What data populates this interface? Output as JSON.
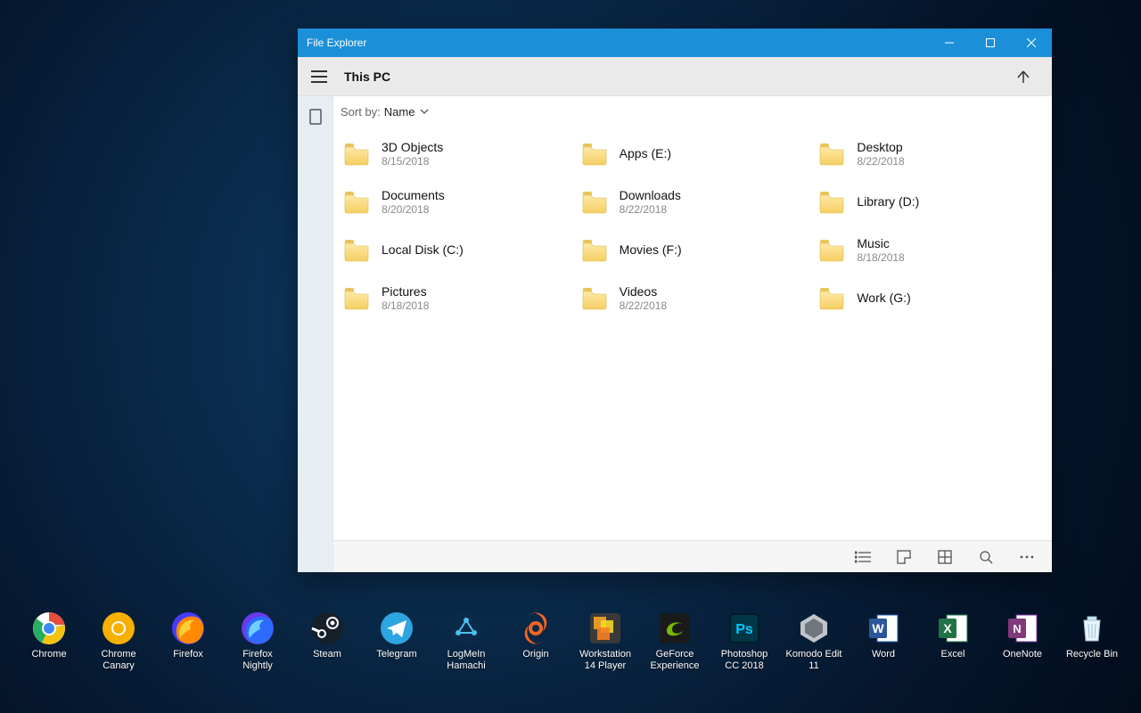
{
  "window": {
    "title": "File Explorer",
    "location": "This PC",
    "sort_label": "Sort by:",
    "sort_value": "Name"
  },
  "items": [
    {
      "name": "3D Objects",
      "date": "8/15/2018"
    },
    {
      "name": "Apps (E:)",
      "date": ""
    },
    {
      "name": "Desktop",
      "date": "8/22/2018"
    },
    {
      "name": "Documents",
      "date": "8/20/2018"
    },
    {
      "name": "Downloads",
      "date": "8/22/2018"
    },
    {
      "name": "Library (D:)",
      "date": ""
    },
    {
      "name": "Local Disk (C:)",
      "date": ""
    },
    {
      "name": "Movies (F:)",
      "date": ""
    },
    {
      "name": "Music",
      "date": "8/18/2018"
    },
    {
      "name": "Pictures",
      "date": "8/18/2018"
    },
    {
      "name": "Videos",
      "date": "8/22/2018"
    },
    {
      "name": "Work (G:)",
      "date": ""
    }
  ],
  "dock": [
    {
      "label": "Chrome",
      "icon": "chrome"
    },
    {
      "label": "Chrome\nCanary",
      "icon": "canary"
    },
    {
      "label": "Firefox",
      "icon": "firefox"
    },
    {
      "label": "Firefox\nNightly",
      "icon": "firefox-nightly"
    },
    {
      "label": "Steam",
      "icon": "steam"
    },
    {
      "label": "Telegram",
      "icon": "telegram"
    },
    {
      "label": "LogMeIn\nHamachi",
      "icon": "hamachi"
    },
    {
      "label": "Origin",
      "icon": "origin"
    },
    {
      "label": "Workstation\n14 Player",
      "icon": "vmware"
    },
    {
      "label": "GeForce\nExperience",
      "icon": "geforce"
    },
    {
      "label": "Photoshop\nCC 2018",
      "icon": "photoshop"
    },
    {
      "label": "Komodo Edit\n11",
      "icon": "komodo"
    },
    {
      "label": "Word",
      "icon": "word"
    },
    {
      "label": "Excel",
      "icon": "excel"
    },
    {
      "label": "OneNote",
      "icon": "onenote"
    },
    {
      "label": "Recycle Bin",
      "icon": "recycle"
    }
  ]
}
